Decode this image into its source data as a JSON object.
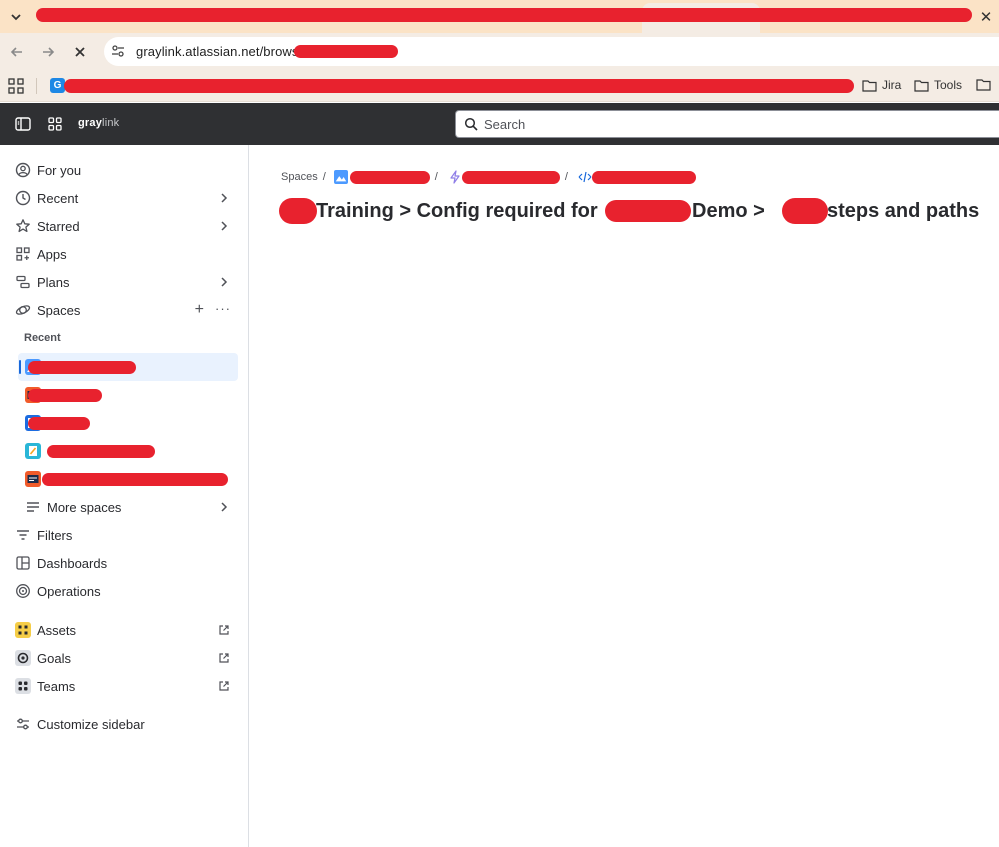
{
  "browser": {
    "url": "graylink.atlassian.net/browse/",
    "bookmarks": [
      {
        "label": "Jira"
      },
      {
        "label": "Tools"
      }
    ]
  },
  "app": {
    "logo_bold": "gray",
    "logo_light": "link",
    "search_placeholder": "Search"
  },
  "sidebar": {
    "items": [
      {
        "label": "For you",
        "icon": "user-circle-icon"
      },
      {
        "label": "Recent",
        "icon": "clock-icon"
      },
      {
        "label": "Starred",
        "icon": "star-icon"
      },
      {
        "label": "Apps",
        "icon": "apps-icon"
      },
      {
        "label": "Plans",
        "icon": "plans-icon"
      },
      {
        "label": "Spaces",
        "icon": "spaces-icon"
      }
    ],
    "recent_header": "Recent",
    "more_spaces": "More spaces",
    "bottom_items": [
      {
        "label": "Filters",
        "icon": "filter-icon"
      },
      {
        "label": "Dashboards",
        "icon": "dashboard-icon"
      },
      {
        "label": "Operations",
        "icon": "operations-icon"
      }
    ],
    "apps_items": [
      {
        "label": "Assets",
        "icon": "assets-icon"
      },
      {
        "label": "Goals",
        "icon": "goals-icon"
      },
      {
        "label": "Teams",
        "icon": "teams-icon"
      }
    ],
    "customize": "Customize sidebar"
  },
  "main": {
    "breadcrumb_root": "Spaces",
    "breadcrumb_sep": "/",
    "title_parts": [
      "Training > Config required for",
      "Demo >",
      "steps and paths"
    ]
  },
  "colors": {
    "header_bg": "#2f3033",
    "accent": "#1868db",
    "redaction": "#e8222e",
    "selected_bg": "#e9f2fe"
  }
}
